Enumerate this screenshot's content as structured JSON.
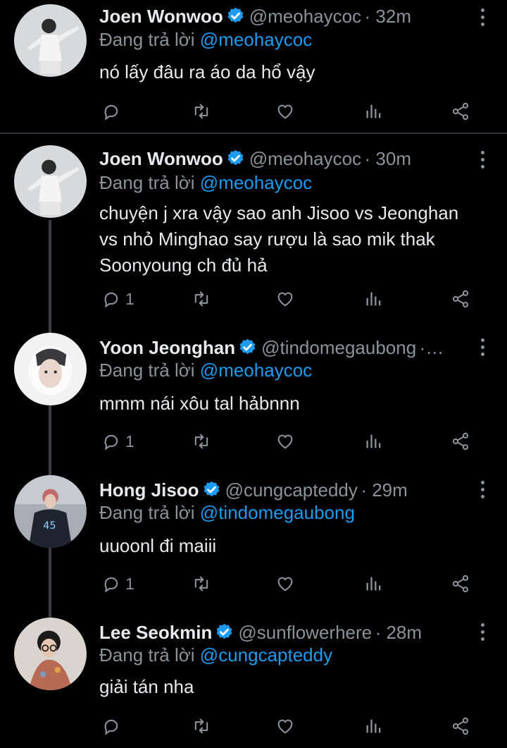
{
  "replying_label": "Đang trả lời",
  "colors": {
    "background": "#000000",
    "text": "#e7e9ea",
    "muted": "#8b9299",
    "accent": "#1d9bf0"
  },
  "tweets": [
    {
      "name": "Joen Wonwoo",
      "handle": "@meohaycoc",
      "time": "· 32m",
      "replying_to": "@meohaycoc",
      "text": [
        "nó lấy đâu ra áo da hổ vậy"
      ],
      "reply_count": ""
    },
    {
      "name": "Joen Wonwoo",
      "handle": "@meohaycoc",
      "time": "· 30m",
      "replying_to": "@meohaycoc",
      "text": [
        "chuyện j xra vậy sao anh Jisoo vs Jeonghan",
        "vs nhỏ Minghao say rượu là sao mik thak",
        "Soonyoung ch đủ hả"
      ],
      "reply_count": "1"
    },
    {
      "name": "Yoon Jeonghan",
      "handle": "@tindomegaubong",
      "time": "·…",
      "replying_to": "@meohaycoc",
      "text": [
        "mmm nái xôu tal hảbnnn"
      ],
      "reply_count": "1"
    },
    {
      "name": "Hong Jisoo",
      "handle": "@cungcapteddy",
      "time": "· 29m",
      "replying_to": "@tindomegaubong",
      "text": [
        "uuoonl đi maiii"
      ],
      "reply_count": "1"
    },
    {
      "name": "Lee Seokmin",
      "handle": "@sunflowerhere",
      "time": "· 28m",
      "replying_to": "@cungcapteddy",
      "text": [
        "giải tán nha"
      ],
      "reply_count": ""
    }
  ],
  "icons": [
    "reply-icon",
    "retweet-icon",
    "like-icon",
    "analytics-icon",
    "share-icon",
    "verified-badge-icon",
    "more-icon"
  ]
}
